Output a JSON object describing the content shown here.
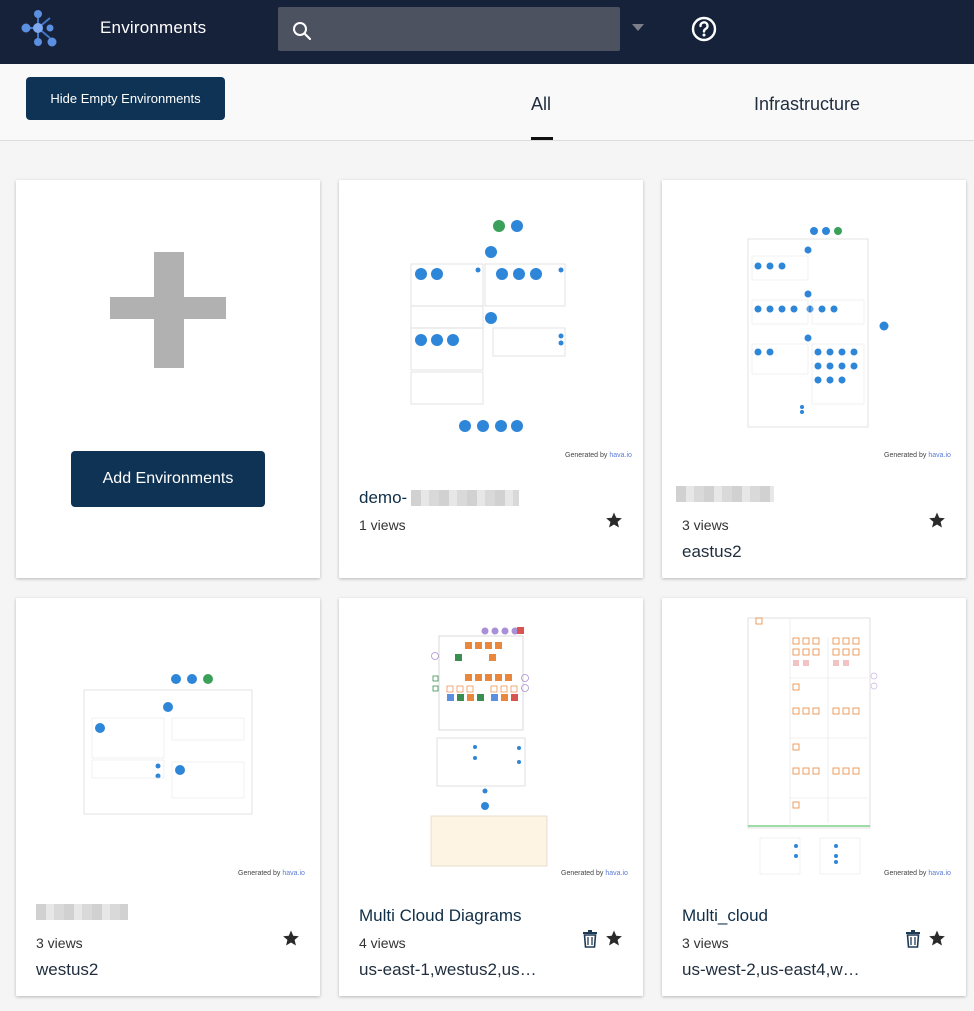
{
  "app": {
    "title": "Environments",
    "logo_icon": "graph-logo-icon"
  },
  "search": {
    "value": "",
    "placeholder": "",
    "icon": "search-icon"
  },
  "header": {
    "help_icon": "help-icon"
  },
  "toolbar": {
    "hide_empty_label": "Hide Empty Environments",
    "tabs": [
      {
        "label": "All",
        "active": true
      },
      {
        "label": "Infrastructure",
        "active": false
      }
    ]
  },
  "add_card": {
    "button_label": "Add Environments"
  },
  "cards": [
    {
      "title": "demo-",
      "views": "1 views",
      "subtitle": "",
      "starred": true,
      "deletable": false,
      "generated_label": "Generated by",
      "generated_brand": "hava.io"
    },
    {
      "title": "",
      "views": "3 views",
      "subtitle": "eastus2",
      "starred": true,
      "deletable": false,
      "generated_label": "Generated by",
      "generated_brand": "hava.io"
    },
    {
      "title": "",
      "views": "3 views",
      "subtitle": "westus2",
      "starred": true,
      "deletable": false,
      "generated_label": "Generated by",
      "generated_brand": "hava.io"
    },
    {
      "title": "Multi Cloud Diagrams",
      "views": "4 views",
      "subtitle": "us-east-1,westus2,us…",
      "starred": true,
      "deletable": true,
      "generated_label": "Generated by",
      "generated_brand": "hava.io"
    },
    {
      "title": "Multi_cloud",
      "views": "3 views",
      "subtitle": "us-west-2,us-east4,w…",
      "starred": true,
      "deletable": true,
      "generated_label": "Generated by",
      "generated_brand": "hava.io"
    }
  ],
  "colors": {
    "header_bg": "#16213a",
    "primary_button": "#0f3354",
    "node_blue": "#2e86d8",
    "aws_orange": "#e9873d"
  }
}
